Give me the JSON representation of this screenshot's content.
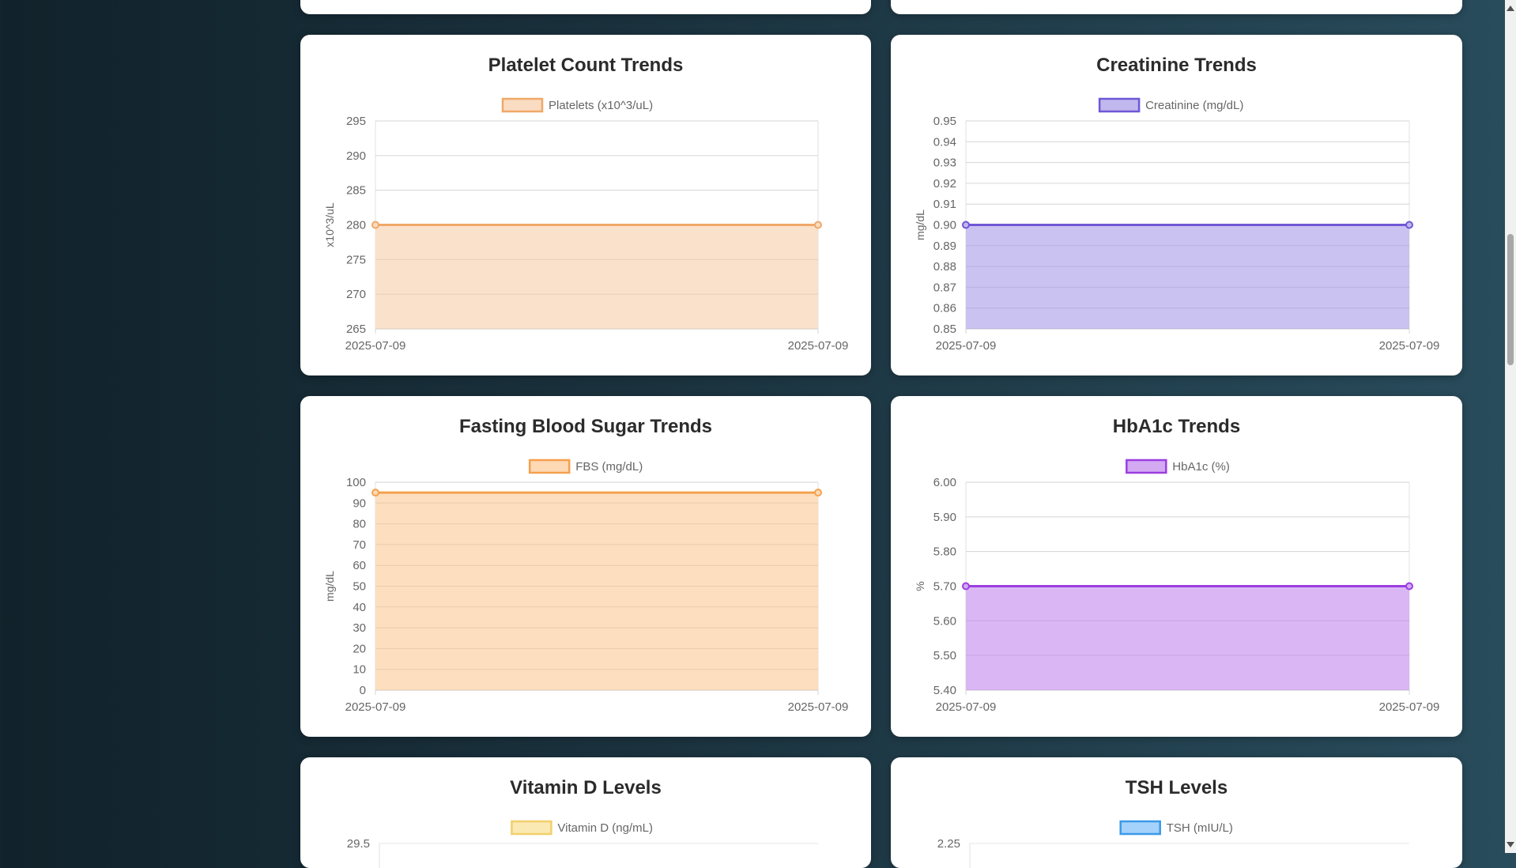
{
  "charts": [
    {
      "id": "platelets",
      "title": "Platelet Count Trends",
      "type": "area",
      "legend": "Platelets (x10^3/uL)",
      "ylabel": "x10^3/uL",
      "ylim": [
        265,
        295
      ],
      "yticks": [
        "295",
        "290",
        "285",
        "280",
        "275",
        "270",
        "265"
      ],
      "xticks": [
        "2025-07-09",
        "2025-07-09"
      ],
      "values": [
        280,
        280
      ],
      "color": "#f0a868",
      "fill": "#f9dcc2",
      "visible": "full"
    },
    {
      "id": "creatinine",
      "title": "Creatinine Trends",
      "type": "area",
      "legend": "Creatinine (mg/dL)",
      "ylabel": "mg/dL",
      "ylim": [
        0.85,
        0.95
      ],
      "yticks": [
        "0.95",
        "0.94",
        "0.93",
        "0.92",
        "0.91",
        "0.90",
        "0.89",
        "0.88",
        "0.87",
        "0.86",
        "0.85"
      ],
      "xticks": [
        "2025-07-09",
        "2025-07-09"
      ],
      "values": [
        0.9,
        0.9
      ],
      "color": "#6f57d6",
      "fill": "#c1b9ee",
      "visible": "full"
    },
    {
      "id": "fbs",
      "title": "Fasting Blood Sugar Trends",
      "type": "area",
      "legend": "FBS (mg/dL)",
      "ylabel": "mg/dL",
      "ylim": [
        0,
        100
      ],
      "yticks": [
        "100",
        "90",
        "80",
        "70",
        "60",
        "50",
        "40",
        "30",
        "20",
        "10",
        "0"
      ],
      "xticks": [
        "2025-07-09",
        "2025-07-09"
      ],
      "values": [
        95,
        95
      ],
      "color": "#f5a04e",
      "fill": "#fdd9b4",
      "visible": "full"
    },
    {
      "id": "hba1c",
      "title": "HbA1c Trends",
      "type": "area",
      "legend": "HbA1c (%)",
      "ylabel": "%",
      "ylim": [
        5.4,
        6.0
      ],
      "yticks": [
        "6.00",
        "5.90",
        "5.80",
        "5.70",
        "5.60",
        "5.50",
        "5.40"
      ],
      "xticks": [
        "2025-07-09",
        "2025-07-09"
      ],
      "values": [
        5.7,
        5.7
      ],
      "color": "#9b3ee0",
      "fill": "#d3aaf2",
      "visible": "full"
    },
    {
      "id": "vitamin-d",
      "title": "Vitamin D Levels",
      "type": "bar",
      "legend": "Vitamin D (ng/mL)",
      "ylabel": "",
      "yticks": [
        "29.5"
      ],
      "xticks": [],
      "values": [],
      "color": "#f2cf6a",
      "fill": "#fbe9b4",
      "visible": "partial"
    },
    {
      "id": "tsh",
      "title": "TSH Levels",
      "type": "bar",
      "legend": "TSH (mIU/L)",
      "ylabel": "",
      "yticks": [
        "2.25"
      ],
      "xticks": [],
      "values": [],
      "color": "#3b99e8",
      "fill": "#a4d2fa",
      "visible": "partial"
    }
  ]
}
